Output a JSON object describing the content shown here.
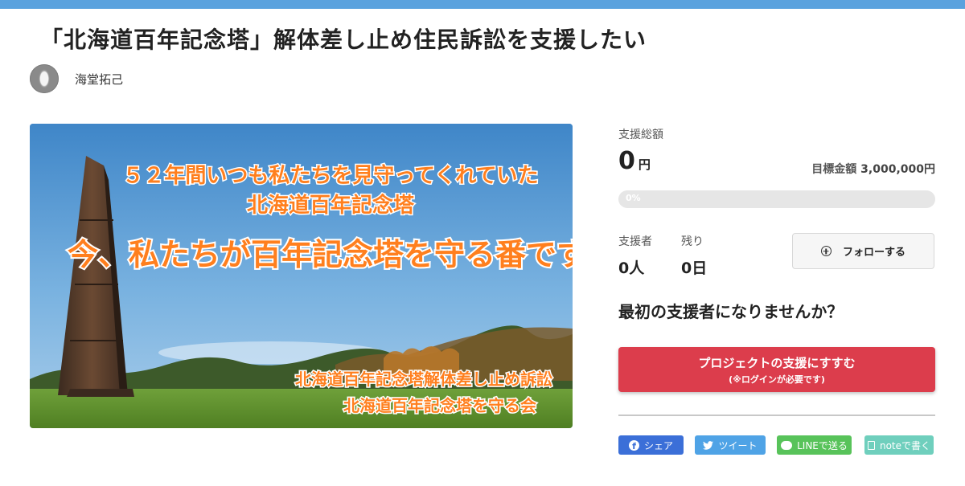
{
  "project": {
    "title": "「北海道百年記念塔」解体差し止め住民訴訟を支援したい",
    "owner_name": "海堂拓己"
  },
  "hero": {
    "line1": "５２年間いつも私たちを見守ってくれていた",
    "line2": "北海道百年記念塔",
    "line3": "今、私たちが百年記念塔を守る番です",
    "line4": "北海道百年記念塔解体差し止め訴訟",
    "line5": "北海道百年記念塔を守る会"
  },
  "stats": {
    "total_label": "支援総額",
    "total_amount": "0",
    "total_unit": "円",
    "goal_label": "目標金額",
    "goal_amount": "3,000,000円",
    "progress_text": "0%",
    "progress_fraction": 0,
    "supporters_label": "支援者",
    "supporters_value": "0人",
    "remaining_label": "残り",
    "remaining_value": "0日"
  },
  "follow": {
    "label": "フォローする",
    "icon": "plus-circle-icon"
  },
  "cta": {
    "question": "最初の支援者になりませんか？",
    "button_line1": "プロジェクトの支援にすすむ",
    "button_line2": "(※ログインが必要です)"
  },
  "share": {
    "facebook": "シェア",
    "twitter": "ツイート",
    "line": "LINEで送る",
    "note": "noteで書く"
  },
  "colors": {
    "topbar": "#5aa2de",
    "accent": "#dc3d4c",
    "facebook": "#3b6fd8",
    "twitter": "#4fa3e6",
    "line": "#58c35a",
    "note": "#6fcfbd",
    "hero_text": "#ff7f1e"
  }
}
